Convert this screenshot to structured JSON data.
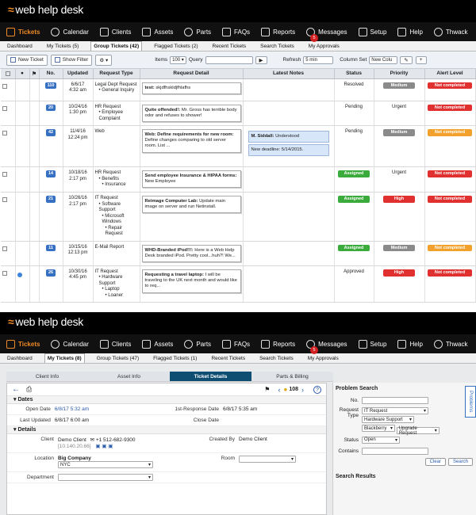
{
  "brand": "web help desk",
  "nav": [
    {
      "label": "Tickets",
      "icon": "tickets-icon",
      "active": true
    },
    {
      "label": "Calendar",
      "icon": "calendar-icon"
    },
    {
      "label": "Clients",
      "icon": "clients-icon"
    },
    {
      "label": "Assets",
      "icon": "assets-icon"
    },
    {
      "label": "Parts",
      "icon": "parts-icon"
    },
    {
      "label": "FAQs",
      "icon": "faqs-icon"
    },
    {
      "label": "Reports",
      "icon": "reports-icon"
    },
    {
      "label": "Messages",
      "icon": "messages-icon",
      "badge": "5"
    },
    {
      "label": "Setup",
      "icon": "setup-icon"
    },
    {
      "label": "Help",
      "icon": "help-icon"
    },
    {
      "label": "Thwack",
      "icon": "thwack-icon"
    }
  ],
  "subnav1": [
    "Dashboard",
    "My Tickets (5)",
    "Group Tickets (42)",
    "Flagged Tickets (2)",
    "Recent Tickets",
    "Search Tickets",
    "My Approvals"
  ],
  "subnav2": [
    "Dashboard",
    "My Tickets (8)",
    "Group Tickets (47)",
    "Flagged Tickets (1)",
    "Recent Tickets",
    "Search Tickets",
    "My Approvals"
  ],
  "toolbar": {
    "new_ticket": "New Ticket",
    "show_filter": "Show Filter",
    "items_label": "Items",
    "items_value": "100",
    "query_label": "Query",
    "refresh_label": "Refresh",
    "refresh_value": "5 min",
    "column_set_label": "Column Set",
    "column_set_value": "New Colu"
  },
  "columns": [
    "No.",
    "Updated",
    "Request Type",
    "Request Detail",
    "Latest Notes",
    "Status",
    "Priority",
    "Alert Level"
  ],
  "tickets": [
    {
      "no": "110",
      "updated": "6/6/17\n4:32 am",
      "type_main": "Legal Dept Request",
      "type_sub": [
        "General Inquiry"
      ],
      "detail_title": "test:",
      "detail_body": " skjdfhskldjfhlafhs",
      "notes": [],
      "status": "Resolved",
      "priority": "Medium",
      "alert": "Not completed"
    },
    {
      "no": "20",
      "updated": "10/24/16\n1:30 pm",
      "type_main": "HR Request",
      "type_sub": [
        "Employee Complaint"
      ],
      "detail_title": "Quite offended!:",
      "detail_body": " Mr. Gross has terrible body odor and refuses to shower!",
      "notes": [],
      "status": "Pending",
      "priority": "Urgent",
      "alert": "Not completed"
    },
    {
      "no": "42",
      "updated": "11/4/16\n12:24 pm",
      "type_main": "Web",
      "type_sub": [],
      "detail_title": "Web: Define requirements for new room:",
      "detail_body": " Define changes comparing to old server room. List ...",
      "notes": [
        {
          "author": "M. Siddall:",
          "text": " Understood"
        },
        {
          "author": "",
          "text": "New deadline: 5/14/2015."
        }
      ],
      "status": "Pending",
      "priority": "Medium",
      "alert": "Not completed"
    },
    {
      "no": "14",
      "updated": "10/18/16\n2:17 pm",
      "type_main": "HR Request",
      "type_sub": [
        "Benefits",
        "Insurance"
      ],
      "detail_title": "Send employee Insurance & HIPAA forms:",
      "detail_body": " New Employee",
      "notes": [],
      "status": "Assigned",
      "priority": "Urgent",
      "alert": "Not completed"
    },
    {
      "no": "21",
      "updated": "10/26/16\n2:17 pm",
      "type_main": "IT Request",
      "type_sub": [
        "Software Support",
        "Microsoft Windows",
        "Repair Request"
      ],
      "detail_title": "Reimage Computer Lab:",
      "detail_body": " Update main image on server and run Netinstall.",
      "notes": [],
      "status": "Assigned",
      "priority": "High",
      "alert": "Not completed"
    },
    {
      "no": "11",
      "updated": "10/15/16\n12:13 pm",
      "type_main": "E-Mail Report",
      "type_sub": [],
      "detail_title": "WHD-Branded iPod!!!:",
      "detail_body": " Here is a Web Help Desk branded iPod. Pretty cool...huh?! We...",
      "notes": [],
      "status": "Assigned",
      "priority": "Medium",
      "alert": "Not completed"
    },
    {
      "no": "26",
      "updated": "10/30/16\n4:45 pm",
      "type_main": "IT Request",
      "type_sub": [
        "Hardware Support",
        "Laptop",
        "Loaner"
      ],
      "detail_title": "Requesting a travel laptop:",
      "detail_body": " I will be traveling to the UK next month and would like to req...",
      "notes": [],
      "status": "Approved",
      "priority": "High",
      "alert": "Not completed"
    }
  ],
  "detail_tabs": [
    "Client Info",
    "Asset Info",
    "Ticket Details",
    "Parts & Billing"
  ],
  "ticket_number": "108",
  "dates": {
    "section": "Dates",
    "open_label": "Open Date",
    "open_value": "6/8/17 5:32 am",
    "first_resp_label": "1st-Response Date",
    "first_resp_value": "6/8/17 5:35 am",
    "updated_label": "Last Updated",
    "updated_value": "6/8/17 6:00 am",
    "close_label": "Close Date",
    "close_value": ""
  },
  "details": {
    "section": "Details",
    "client_label": "Client",
    "client_value": "Demo Client",
    "phone": "+1 512-682-9300",
    "ip": "[10.140.20.66]",
    "created_label": "Created By",
    "created_value": "Demo Client",
    "location_label": "Location",
    "location_value": "Big Company",
    "location_sub": "NYC",
    "room_label": "Room",
    "dept_label": "Department"
  },
  "problem_search": {
    "title": "Problem Search",
    "no_label": "No.",
    "request_type_label": "Request Type",
    "request_type_values": [
      "IT Request",
      "Hardware Support",
      "Blackberry",
      "Upgrade Request"
    ],
    "status_label": "Status",
    "status_value": "Open",
    "contains_label": "Contains",
    "clear": "Clear",
    "search": "Search",
    "results_title": "Search Results",
    "problems_tab": "Problems"
  },
  "colors": {
    "accent": "#f08a24",
    "active_tab": "#0f4e73",
    "id_badge": "#3670c2"
  }
}
